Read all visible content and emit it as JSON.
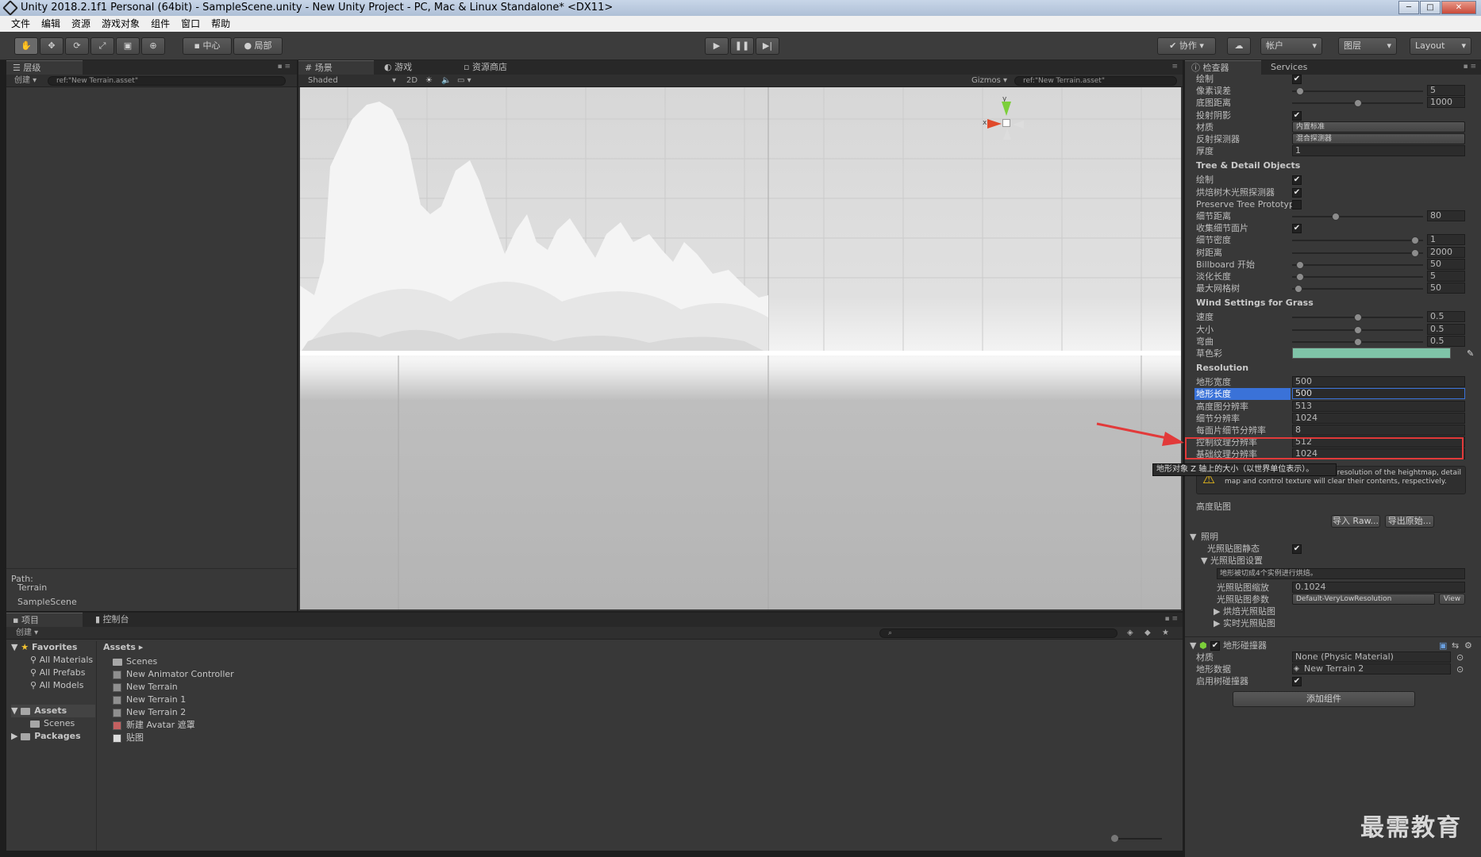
{
  "title": "Unity 2018.2.1f1 Personal (64bit) - SampleScene.unity - New Unity Project - PC, Mac & Linux Standalone* <DX11>",
  "menu": [
    "文件",
    "编辑",
    "资源",
    "游戏对象",
    "组件",
    "窗口",
    "帮助"
  ],
  "toolbar": {
    "pivot": "中心",
    "local": "局部",
    "collab": "协作",
    "account": "帐户",
    "layers": "图层",
    "layout": "Layout"
  },
  "hierarchy": {
    "tab": "层级",
    "create": "创建",
    "search": "ref:\"New Terrain.asset\"",
    "path_label": "Path:",
    "path": [
      "Terrain",
      "SampleScene"
    ]
  },
  "scene": {
    "tabs": [
      "场景",
      "游戏",
      "资源商店"
    ],
    "shading": "Shaded",
    "mode2d": "2D",
    "gizmos": "Gizmos",
    "search": "ref:\"New Terrain.asset\"",
    "axis_x": "x",
    "axis_y": "y"
  },
  "inspector": {
    "tabs": [
      "检查器",
      "Services"
    ],
    "rows_top": [
      {
        "label": "绘制",
        "type": "check",
        "checked": true
      },
      {
        "label": "像素误差",
        "type": "slider",
        "value": "5",
        "pos": 0.03
      },
      {
        "label": "底图距离",
        "type": "slider",
        "value": "1000",
        "pos": 0.5
      },
      {
        "label": "投射阴影",
        "type": "check",
        "checked": true
      },
      {
        "label": "材质",
        "type": "dropdown",
        "value": "内置标准"
      },
      {
        "label": "反射探测器",
        "type": "dropdown",
        "value": "混合探测器"
      },
      {
        "label": "厚度",
        "type": "field",
        "value": "1"
      }
    ],
    "tree_header": "Tree & Detail Objects",
    "tree_rows": [
      {
        "label": "绘制",
        "type": "check",
        "checked": true
      },
      {
        "label": "烘焙树木光照探测器",
        "type": "check",
        "checked": true
      },
      {
        "label": "Preserve Tree Prototyp",
        "type": "check",
        "checked": false
      },
      {
        "label": "细节距离",
        "type": "slider",
        "value": "80",
        "pos": 0.32
      },
      {
        "label": "收集细节面片",
        "type": "check",
        "checked": true
      },
      {
        "label": "细节密度",
        "type": "slider",
        "value": "1",
        "pos": 0.97
      },
      {
        "label": "树距离",
        "type": "slider",
        "value": "2000",
        "pos": 0.97
      },
      {
        "label": "Billboard 开始",
        "type": "slider",
        "value": "50",
        "pos": 0.03
      },
      {
        "label": "淡化长度",
        "type": "slider",
        "value": "5",
        "pos": 0.03
      },
      {
        "label": "最大网格树",
        "type": "slider",
        "value": "50",
        "pos": 0.02
      }
    ],
    "wind_header": "Wind Settings for Grass",
    "wind_rows": [
      {
        "label": "速度",
        "type": "slider",
        "value": "0.5",
        "pos": 0.5
      },
      {
        "label": "大小",
        "type": "slider",
        "value": "0.5",
        "pos": 0.5
      },
      {
        "label": "弯曲",
        "type": "slider",
        "value": "0.5",
        "pos": 0.5
      },
      {
        "label": "草色彩",
        "type": "color",
        "value": "#7fc4a8"
      }
    ],
    "res_header": "Resolution",
    "res_rows": [
      {
        "label": "地形宽度",
        "value": "500"
      },
      {
        "label": "地形长度",
        "value": "500",
        "selected": true
      },
      {
        "label": "高度图分辨率",
        "value": "513"
      },
      {
        "label": "细节分辨率",
        "value": "1024"
      },
      {
        "label": "每面片细节分辨率",
        "value": "8"
      },
      {
        "label": "控制纹理分辨率",
        "value": "512"
      },
      {
        "label": "基础纹理分辨率",
        "value": "1024"
      }
    ],
    "tooltip": "地形对象 Z 轴上的大小（以世界单位表示）。",
    "warning": "Please note that modifying the resolution of the heightmap, detail map and control texture will clear their contents, respectively.",
    "heightmap_label": "高度贴图",
    "import_raw": "导入 Raw...",
    "export_raw": "导出原始...",
    "lighting": {
      "header": "照明",
      "static_label": "光照贴图静态",
      "settings_label": "光照贴图设置",
      "info": "地形被切成4个实例进行烘焙。",
      "scale_label": "光照贴图缩放",
      "scale_value": "0.1024",
      "params_label": "光照贴图参数",
      "params_value": "Default-VeryLowResolution",
      "view": "View",
      "baked": "烘焙光照贴图",
      "realtime": "实时光照贴图"
    },
    "collider": {
      "header": "地形碰撞器",
      "material_label": "材质",
      "material_value": "None (Physic Material)",
      "data_label": "地形数据",
      "data_value": "New Terrain 2",
      "trees_label": "启用树碰撞器"
    },
    "add_component": "添加组件"
  },
  "project": {
    "tabs": [
      "项目",
      "控制台"
    ],
    "create": "创建",
    "favorites_label": "Favorites",
    "favorites": [
      "All Materials",
      "All Prefabs",
      "All Models"
    ],
    "assets_label": "Assets",
    "scenes_label": "Scenes",
    "packages_label": "Packages",
    "breadcrumb": "Assets",
    "files": [
      "Scenes",
      "New Animator Controller",
      "New Terrain",
      "New Terrain 1",
      "New Terrain 2",
      "新建 Avatar 遮罩",
      "贴图"
    ]
  },
  "watermark": "最需教育",
  "colors": {
    "accent_red": "#e23a3a",
    "selection": "#3a72d8"
  }
}
